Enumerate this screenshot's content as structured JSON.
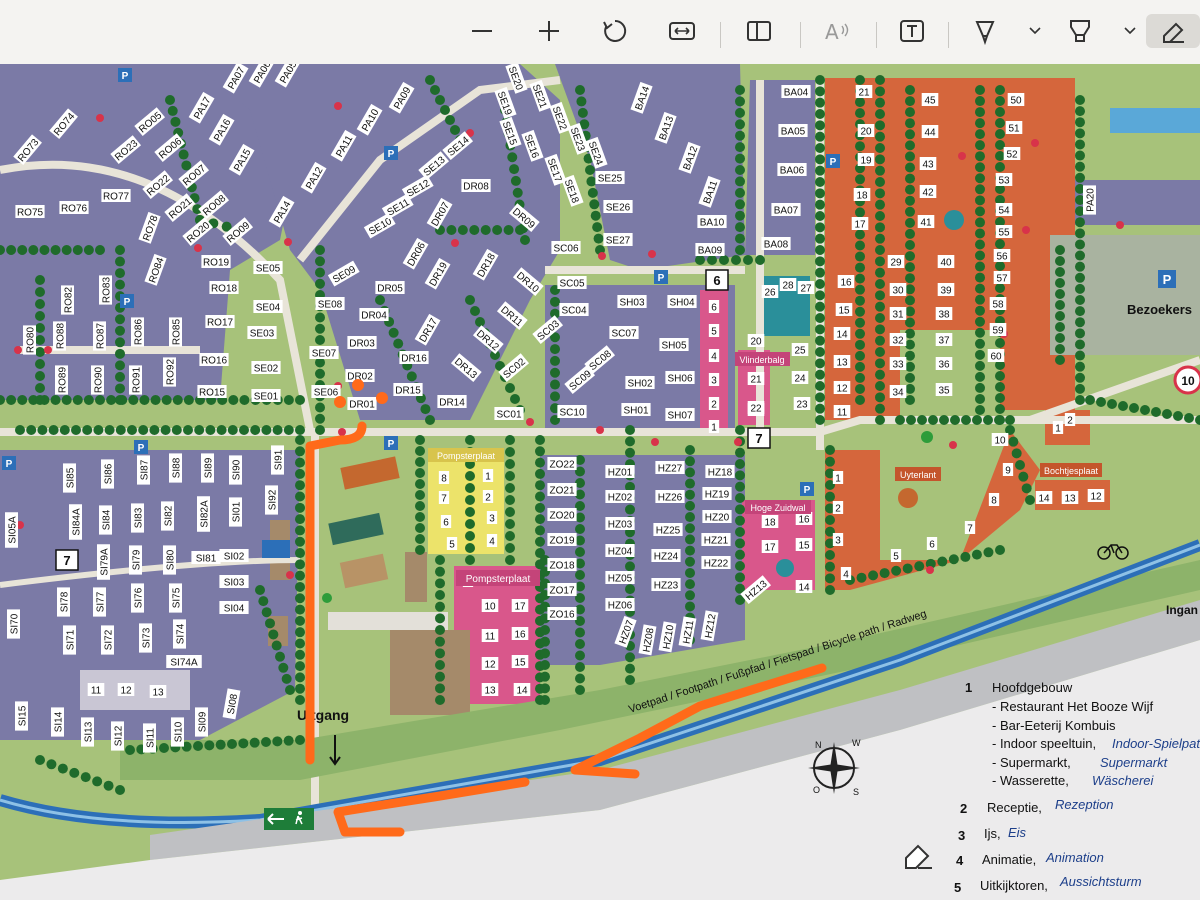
{
  "toolbar": {
    "zoom_out_icon": "minus-icon",
    "zoom_in_icon": "plus-icon",
    "rotate_icon": "rotate-icon",
    "fit_width_icon": "fit-width-icon",
    "page_view_icon": "page-view-icon",
    "read_aloud_icon": "read-aloud-icon",
    "text_icon": "text-box-icon",
    "draw_icon": "pen-icon",
    "highlight_icon": "highlighter-icon",
    "erase_icon": "eraser-icon"
  },
  "map": {
    "roads": {
      "path_label": "Voetpad / Footpath / Fußpfad / Fietspad / Bicycle path / Radweg",
      "exit_label": "Uitgang",
      "visitor_label": "Bezoekers",
      "edge_label": "Ingan"
    },
    "area_labels": {
      "pompsterplaat_a": "Pompsterplaat",
      "pompsterplaat_b": "Pompsterplaat",
      "vlinderbalg": "Vlinderbalg",
      "hoge_zuidwal": "Hoge Zuidwal",
      "uyterlant": "Uyterlant",
      "bochtjesplaat": "Bochtjesplaat"
    },
    "markers": {
      "m6": "6",
      "m7a": "7",
      "m7b": "7",
      "m7c": "7",
      "m9": "9",
      "m10": "10",
      "m10b": "10",
      "speed": "10"
    },
    "lots": {
      "se": [
        "SE01",
        "SE02",
        "SE03",
        "SE04",
        "SE05",
        "SE06",
        "SE07",
        "SE08",
        "SE09",
        "SE10",
        "SE11",
        "SE12",
        "SE13",
        "SE14",
        "SE15",
        "SE16",
        "SE17",
        "SE18",
        "SE19",
        "SE20",
        "SE21",
        "SE22",
        "SE23",
        "SE24",
        "SE25",
        "SE26",
        "SE27"
      ],
      "dr": [
        "DR01",
        "DR02",
        "DR03",
        "DR04",
        "DR05",
        "DR06",
        "DR07",
        "DR08",
        "DR09",
        "DR10",
        "DR11",
        "DR12",
        "DR13",
        "DR14",
        "DR15",
        "DR16",
        "DR17",
        "DR18",
        "DR19"
      ],
      "sc": [
        "SC01",
        "SC02",
        "SC03",
        "SC04",
        "SC05",
        "SC06",
        "SC07",
        "SC08",
        "SC09",
        "SC10"
      ],
      "sh": [
        "SH01",
        "SH02",
        "SH03",
        "SH04",
        "SH05",
        "SH06",
        "SH07"
      ],
      "hz": [
        "HZ01",
        "HZ02",
        "HZ03",
        "HZ04",
        "HZ05",
        "HZ06",
        "HZ07",
        "HZ08",
        "HZ10",
        "HZ11",
        "HZ12",
        "HZ13",
        "HZ18",
        "HZ19",
        "HZ20",
        "HZ21",
        "HZ22",
        "HZ23",
        "HZ24",
        "HZ25",
        "HZ26",
        "HZ27"
      ],
      "zo": [
        "ZO16",
        "ZO17",
        "ZO18",
        "ZO19",
        "ZO20",
        "ZO21",
        "ZO22"
      ],
      "ro": [
        "RO05",
        "RO06",
        "RO07",
        "RO08",
        "RO09",
        "RO15",
        "RO16",
        "RO17",
        "RO18",
        "RO19",
        "RO20",
        "RO21",
        "RO22",
        "RO23",
        "RO73",
        "RO74",
        "RO75",
        "RO76",
        "RO77",
        "RO78",
        "RO80",
        "RO82",
        "RO83",
        "RO84",
        "RO85",
        "RO86",
        "RO87",
        "RO88",
        "RO89",
        "RO90",
        "RO91",
        "RO92"
      ],
      "pa": [
        "PA07",
        "PA06",
        "PA05",
        "PA09",
        "PA10",
        "PA11",
        "PA12",
        "PA14",
        "PA15",
        "PA16",
        "PA17"
      ],
      "ba": [
        "BA04",
        "BA05",
        "BA06",
        "BA07",
        "BA08",
        "BA09",
        "BA10",
        "BA11",
        "BA12",
        "BA13",
        "BA14"
      ],
      "si": [
        "SI85",
        "SI86",
        "SI87",
        "SI88",
        "SI89",
        "SI90",
        "SI91",
        "SI92",
        "SI84A",
        "SI84",
        "SI83",
        "SI82",
        "SI82A",
        "SI81",
        "SI80",
        "SI79",
        "SI79A",
        "SI78",
        "SI77",
        "SI76",
        "SI75",
        "SI74",
        "SI74A",
        "SI73",
        "SI72",
        "SI71",
        "SI70",
        "SI15",
        "SI14",
        "SI13",
        "SI12",
        "SI11",
        "SI10",
        "SI09",
        "SI08",
        "SI01",
        "SI02",
        "SI03",
        "SI04",
        "SI05A"
      ]
    },
    "numbered_orange": [
      "1",
      "2",
      "3",
      "4",
      "5",
      "6",
      "7",
      "8",
      "9",
      "10",
      "11",
      "12",
      "13",
      "14",
      "15",
      "16",
      "17",
      "18",
      "19",
      "20",
      "21",
      "22",
      "23",
      "24",
      "25",
      "26",
      "27",
      "28",
      "29",
      "30",
      "31",
      "32",
      "33",
      "34",
      "35",
      "36",
      "37",
      "38",
      "39",
      "40",
      "41",
      "42",
      "43",
      "44",
      "45",
      "50",
      "51",
      "52",
      "53",
      "54",
      "55",
      "56",
      "57",
      "58",
      "59",
      "60"
    ],
    "pompsterplaat_yellow": [
      "8",
      "1",
      "7",
      "2",
      "6",
      "3",
      "5",
      "4"
    ],
    "pompsterplaat_pink": [
      "10",
      "17",
      "11",
      "16",
      "12",
      "15",
      "13",
      "14"
    ],
    "vlinderbalg": [
      "6",
      "5",
      "4",
      "3",
      "2",
      "1",
      "20",
      "21",
      "22"
    ],
    "hoge_zuidwal": [
      "18",
      "17",
      "16",
      "15",
      "14"
    ],
    "uyterlant_cluster": [
      "1",
      "2"
    ],
    "bochtjesplaat": [
      "14",
      "13",
      "12"
    ],
    "si_numbers": [
      "11",
      "12",
      "13"
    ]
  },
  "legend": {
    "items": [
      {
        "num": "1",
        "title": "Hoofdgebouw",
        "sub": [
          {
            "nl": "- Restaurant Het Booze Wijf",
            "de": ""
          },
          {
            "nl": "- Bar-Eeterij Kombuis",
            "de": ""
          },
          {
            "nl": "- Indoor speeltuin,",
            "de": "Indoor-Spielpatz"
          },
          {
            "nl": "- Supermarkt,",
            "de": "Supermarkt"
          },
          {
            "nl": "- Wasserette,",
            "de": "Wäscherei"
          }
        ]
      },
      {
        "num": "2",
        "title": "Receptie,",
        "de": "Rezeption"
      },
      {
        "num": "3",
        "title": "Ijs,",
        "de": "Eis"
      },
      {
        "num": "4",
        "title": "Animatie,",
        "de": "Animation"
      },
      {
        "num": "5",
        "title": "Uitkijktoren,",
        "de": "Aussichtsturm"
      }
    ]
  },
  "annotation": {
    "color": "#ff6a1a"
  },
  "colors": {
    "purple": "#7b7aa6",
    "orange": "#d5663c",
    "pink": "#d9578b",
    "yellow": "#ece36a",
    "teal": "#2a8f9a",
    "water": "#2c6fb8",
    "grass": "#9fbc73",
    "tree": "#1f6b2b"
  }
}
